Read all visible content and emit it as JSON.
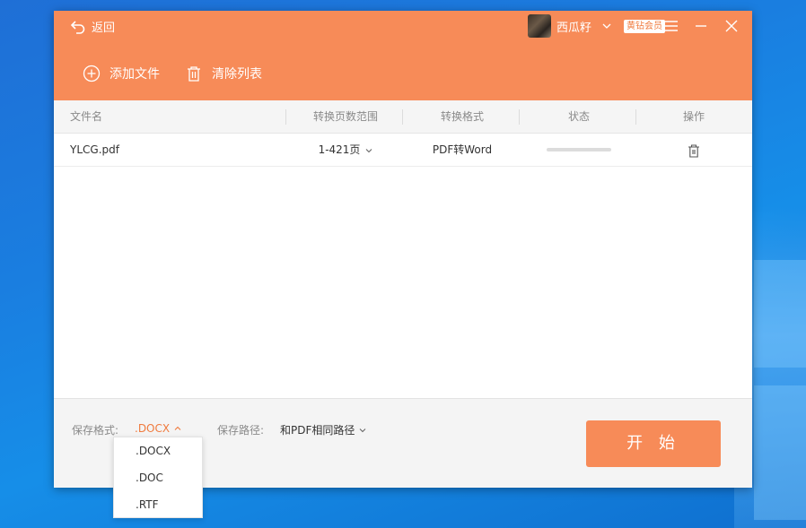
{
  "header": {
    "back_label": "返回",
    "user_name": "西瓜籽",
    "vip_badge": "黄钻会员",
    "add_file_label": "添加文件",
    "clear_list_label": "清除列表"
  },
  "table": {
    "columns": [
      "文件名",
      "转换页数范围",
      "转换格式",
      "状态",
      "操作"
    ],
    "rows": [
      {
        "file_name": "YLCG.pdf",
        "page_range": "1-421页",
        "format": "PDF转Word",
        "progress": 0
      }
    ]
  },
  "footer": {
    "save_format_label": "保存格式:",
    "save_format_value": ".DOCX",
    "save_path_label": "保存路径:",
    "save_path_value": "和PDF相同路径",
    "start_label": "开 始"
  },
  "format_dropdown": {
    "options": [
      ".DOCX",
      ".DOC",
      ".RTF"
    ]
  },
  "colors": {
    "accent": "#f78b58",
    "accent_text": "#f07a3d"
  }
}
